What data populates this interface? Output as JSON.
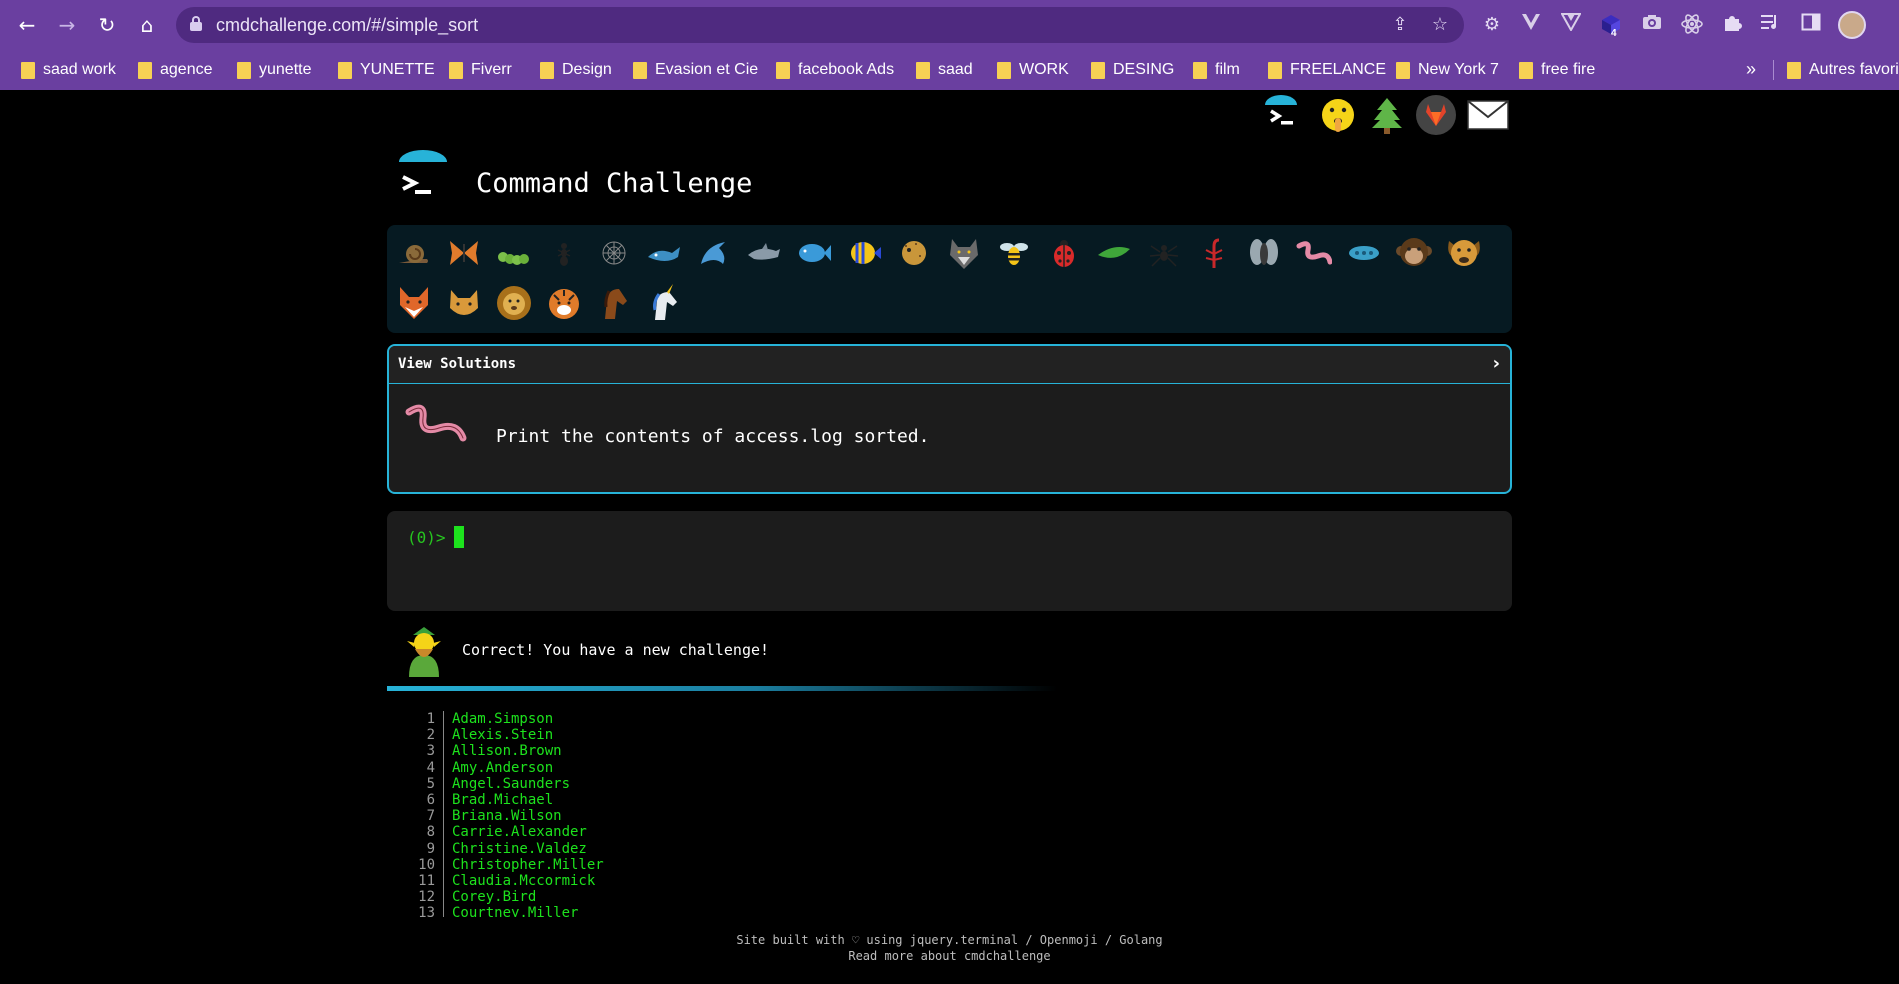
{
  "browser": {
    "url": "cmdchallenge.com/#/simple_sort",
    "nav_icons": {
      "back": "←",
      "forward": "→",
      "reload": "↻",
      "home": "⌂"
    },
    "url_icons": {
      "share": "⇪",
      "bookmark_star": "☆"
    },
    "extensions": [
      "gear-extension-icon",
      "vuetify-triangle-icon",
      "vue-triangle-icon",
      "purple-cube-icon",
      "camera-icon",
      "react-atom-icon",
      "puzzle-icon",
      "media-queue-icon",
      "side-panel-icon"
    ],
    "extension_badge": "4",
    "bookmarks": [
      "saad work",
      "agence",
      "yunette",
      "YUNETTE",
      "Fiverr",
      "Design",
      "Evasion et Cie",
      "facebook Ads",
      "saad",
      "WORK",
      "DESING",
      "film",
      "FREELANCE",
      "New York 7",
      "free fire"
    ],
    "bookmarks_overflow": "»",
    "other_bookmarks": "Autres favori"
  },
  "page": {
    "top_icons": [
      "terminal-logo-icon",
      "shushing-face-icon",
      "tree-icon",
      "gitlab-icon",
      "envelope-icon"
    ],
    "title": "Command Challenge",
    "challenge_icons": [
      "snail",
      "butterfly",
      "caterpillar",
      "ant",
      "spider-web",
      "whale",
      "dolphin-jump",
      "dolphin",
      "fish",
      "tropical-fish",
      "blowfish",
      "wolf",
      "bee",
      "ladybug",
      "pea-pod",
      "spider",
      "scorpion",
      "fly",
      "worm",
      "microbe",
      "monkey",
      "dog",
      "fox",
      "cat",
      "lion",
      "tiger",
      "horse",
      "unicorn"
    ],
    "view_solutions": "View Solutions",
    "chevron": "›",
    "challenge_text": "Print the contents of access.log sorted.",
    "prompt": "(0)>",
    "feedback_text": "Correct! You have a new challenge!",
    "output_lines": [
      "Adam.Simpson",
      "Alexis.Stein",
      "Allison.Brown",
      "Amy.Anderson",
      "Angel.Saunders",
      "Brad.Michael",
      "Briana.Wilson",
      "Carrie.Alexander",
      "Christine.Valdez",
      "Christopher.Miller",
      "Claudia.Mccormick",
      "Corey.Bird",
      "Courtney.Miller"
    ],
    "footer_line1": "Site built with ♡ using jquery.terminal / Openmoji / Golang",
    "footer_line2": "Read more about cmdchallenge"
  },
  "colors": {
    "chrome": "#6a3fa0",
    "accent": "#27b3d8",
    "terminal_green": "#1de21d"
  }
}
